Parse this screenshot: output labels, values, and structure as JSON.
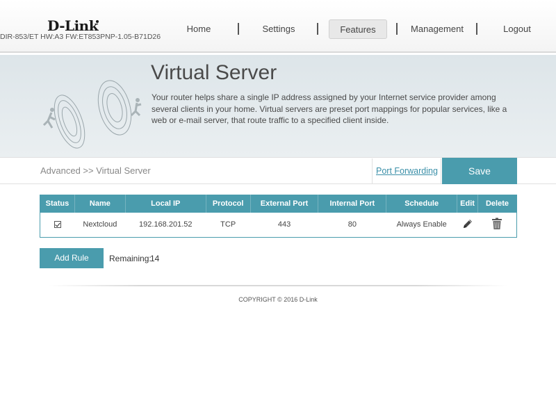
{
  "header": {
    "logo": "D-Link",
    "firmware": "DIR-853/ET HW:A3 FW:ET853PNP-1.05-B71D26",
    "nav": [
      "Home",
      "Settings",
      "Features",
      "Management",
      "Logout"
    ],
    "active_nav": "Features"
  },
  "banner": {
    "title": "Virtual Server",
    "description": "Your router helps share a single IP address assigned by your Internet service provider among several clients in your home. Virtual servers are preset port mappings for popular services, like a web or e-mail server, that route traffic to a specified client inside."
  },
  "breadcrumb": "Advanced >> Virtual Server",
  "port_forwarding_link": "Port Forwarding",
  "save_label": "Save",
  "table": {
    "headers": [
      "Status",
      "Name",
      "Local IP",
      "Protocol",
      "External Port",
      "Internal Port",
      "Schedule",
      "Edit",
      "Delete"
    ],
    "rows": [
      {
        "status": true,
        "name": "Nextcloud",
        "local_ip": "192.168.201.52",
        "protocol": "TCP",
        "external_port": "443",
        "internal_port": "80",
        "schedule": "Always Enable"
      }
    ]
  },
  "add_rule_label": "Add Rule",
  "remaining_label": "Remaining:",
  "remaining_value": "14",
  "copyright": "COPYRIGHT © 2016 D-Link",
  "colors": {
    "accent": "#4a9cad",
    "link": "#3a8fa8",
    "banner_bg": "#e2e9ec"
  },
  "icons": {
    "edit": "pencil-icon",
    "delete": "trash-icon",
    "banner": "router-illustration"
  }
}
